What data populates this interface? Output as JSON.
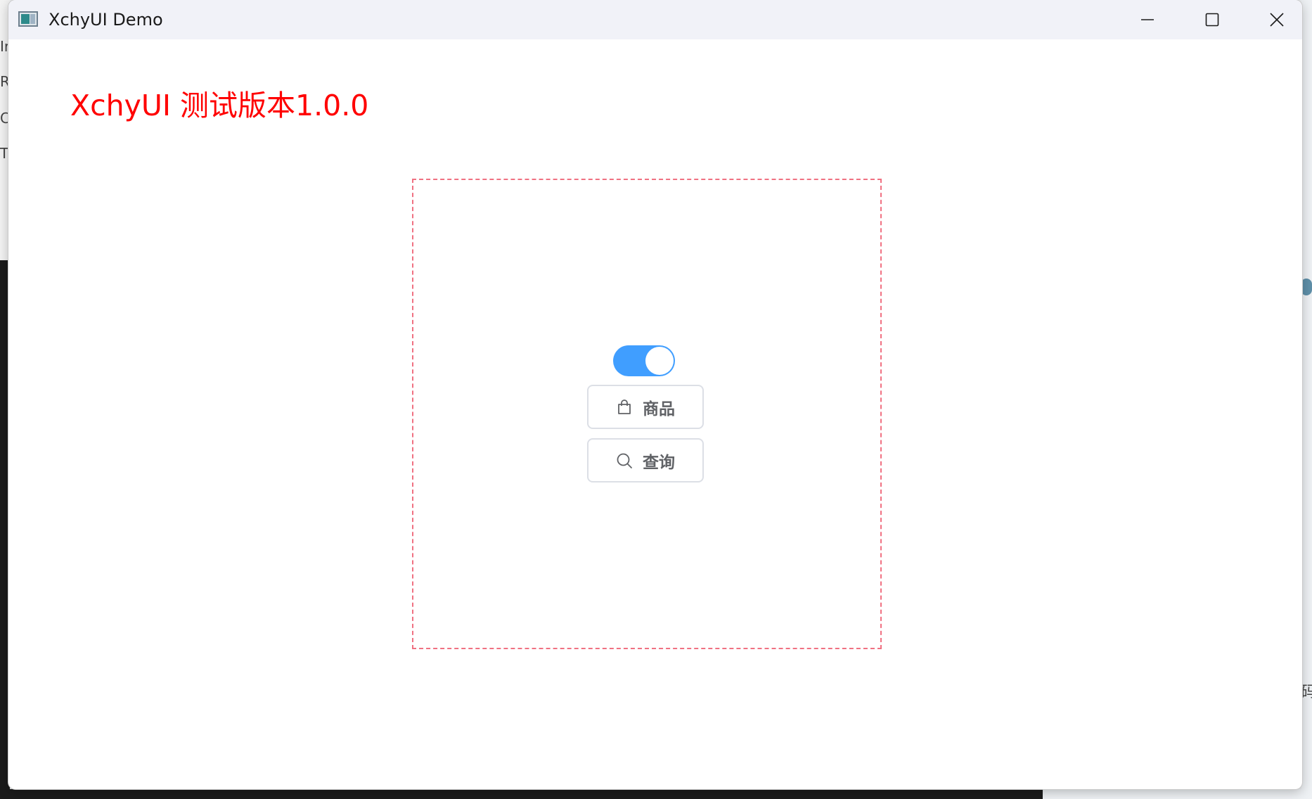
{
  "window": {
    "title": "XchyUI Demo"
  },
  "main": {
    "heading": "XchyUI 测试版本1.0.0",
    "toggle": {
      "checked": true
    },
    "buttons": [
      {
        "label": "商品",
        "icon": "shopping-bag-icon"
      },
      {
        "label": "查询",
        "icon": "search-icon"
      }
    ]
  },
  "background": {
    "left_letters": [
      "Ir",
      "R",
      "C",
      "TI"
    ],
    "right_char": "码"
  },
  "colors": {
    "heading": "#ff0000",
    "toggle_on": "#409eff",
    "dashed_border": "#f07182",
    "button_text": "#606266",
    "button_border": "#dcdfe6"
  }
}
